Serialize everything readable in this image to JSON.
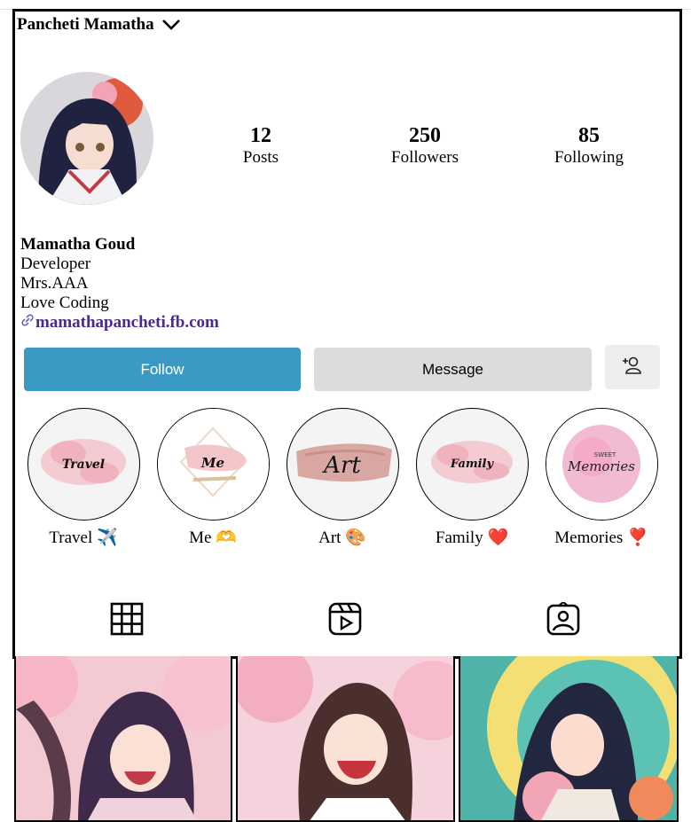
{
  "header": {
    "username": "Pancheti Mamatha"
  },
  "stats": [
    {
      "value": "12",
      "label": "Posts"
    },
    {
      "value": "250",
      "label": "Followers"
    },
    {
      "value": "85",
      "label": "Following"
    }
  ],
  "bio": {
    "name": "Mamatha Goud",
    "lines": [
      "Developer",
      "Mrs.AAA",
      "Love Coding"
    ],
    "link": "mamathapancheti.fb.com"
  },
  "buttons": {
    "follow": "Follow",
    "message": "Message",
    "add_user_icon": "add-user-icon"
  },
  "highlights": [
    {
      "label": "Travel ✈️",
      "art_text": "Travel"
    },
    {
      "label": "Me 🫶",
      "art_text": "Me"
    },
    {
      "label": "Art 🎨",
      "art_text": "Art"
    },
    {
      "label": "Family ❤️",
      "art_text": "Family"
    },
    {
      "label": "Memories ❣️",
      "art_text": "Memories",
      "art_small": "SWEET"
    }
  ],
  "tabs": [
    {
      "icon": "grid-icon"
    },
    {
      "icon": "reels-icon"
    },
    {
      "icon": "tagged-icon"
    }
  ],
  "colors": {
    "follow_button": "#3b9ac4",
    "message_button": "#dcdcdc",
    "link": "#4a2a8a"
  }
}
